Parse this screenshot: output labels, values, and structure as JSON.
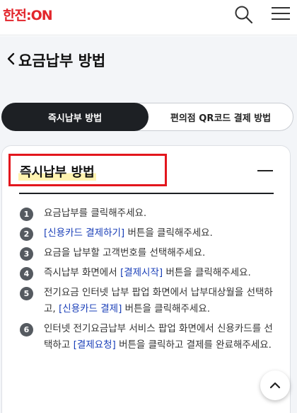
{
  "header": {
    "logo_prefix": "한전:",
    "logo_suffix": "ON"
  },
  "page": {
    "title": "요금납부 방법"
  },
  "tabs": [
    {
      "label": "즉시납부 방법",
      "active": true
    },
    {
      "label": "편의점 QR코드 결제 방법",
      "active": false
    }
  ],
  "section": {
    "title": "즉시납부 방법"
  },
  "steps": [
    {
      "num": "1",
      "parts": [
        {
          "t": "요금납부를 클릭해주세요."
        }
      ]
    },
    {
      "num": "2",
      "parts": [
        {
          "t": "[신용카드 결제하기]",
          "hl": true
        },
        {
          "t": " 버튼을 클릭해주세요."
        }
      ]
    },
    {
      "num": "3",
      "parts": [
        {
          "t": "요금을 납부할 고객번호를 선택해주세요."
        }
      ]
    },
    {
      "num": "4",
      "parts": [
        {
          "t": "즉시납부 화면에서 "
        },
        {
          "t": "[결제시작]",
          "hl": true
        },
        {
          "t": " 버튼을 클릭해주세요."
        }
      ]
    },
    {
      "num": "5",
      "parts": [
        {
          "t": "전기요금 인터넷 납부 팝업 화면에서 납부대상월을 선택하고, "
        },
        {
          "t": "[신용카드 결제]",
          "hl": true
        },
        {
          "t": " 버튼을 클릭해주세요."
        }
      ]
    },
    {
      "num": "6",
      "parts": [
        {
          "t": "인터넷 전기요금납부 서비스 팝업 화면에서 신용카드를 선택하고 "
        },
        {
          "t": "[결제요청]",
          "hl": true
        },
        {
          "t": " 버튼을 클릭하고 결제를 완료해주세요."
        }
      ]
    }
  ],
  "colors": {
    "brand": "#e2262c",
    "link": "#1a3fb8",
    "active_tab": "#1d2024"
  },
  "icons": [
    "search-icon",
    "hamburger-menu-icon",
    "chevron-left-icon",
    "collapse-icon",
    "chevron-up-icon"
  ]
}
